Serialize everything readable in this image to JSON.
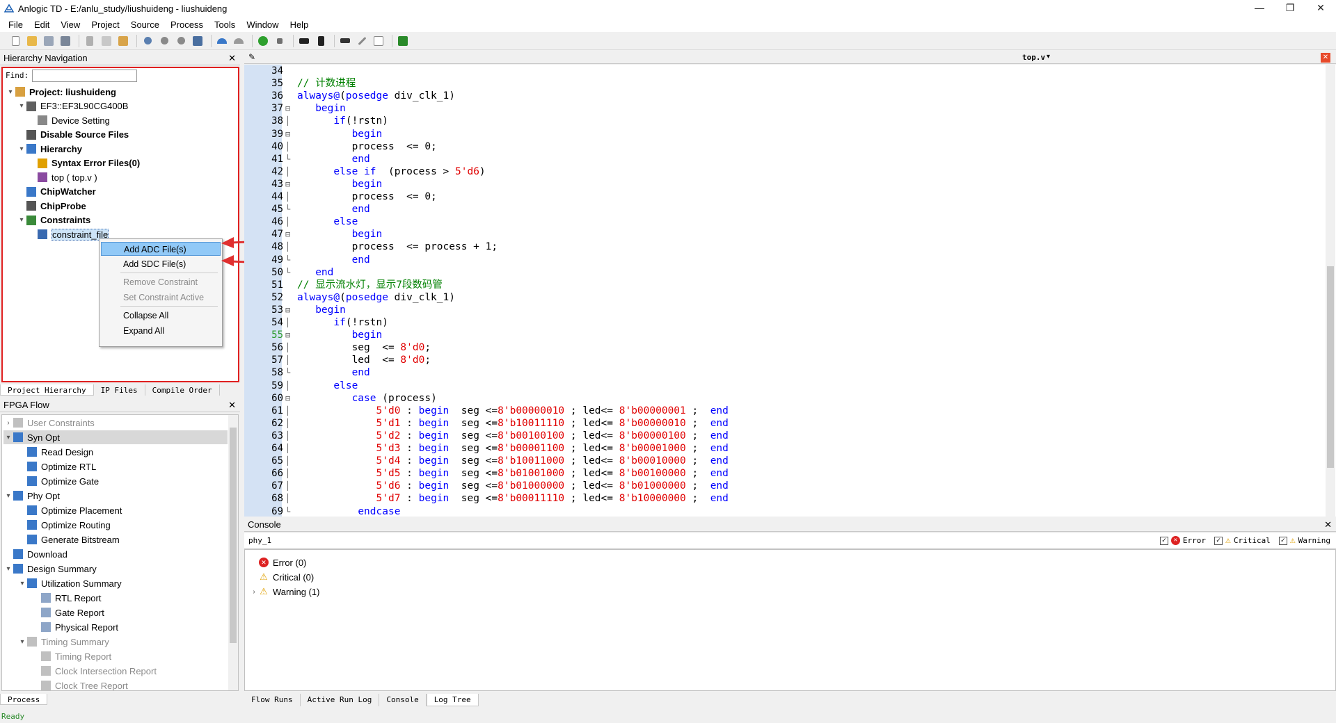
{
  "window": {
    "title": "Anlogic TD - E:/anlu_study/liushuideng - liushuideng",
    "minimize": "—",
    "restore": "❐",
    "close": "✕"
  },
  "menu": [
    "File",
    "Edit",
    "View",
    "Project",
    "Source",
    "Process",
    "Tools",
    "Window",
    "Help"
  ],
  "hierarchy": {
    "title": "Hierarchy Navigation",
    "find_label": "Find:",
    "find_value": "",
    "nodes": [
      {
        "label": "Project: liushuideng",
        "level": 0,
        "bold": true,
        "expand": "v"
      },
      {
        "label": "EF3::EF3L90CG400B",
        "level": 1,
        "bold": false,
        "expand": "v"
      },
      {
        "label": "Device Setting",
        "level": 2,
        "bold": false,
        "expand": ""
      },
      {
        "label": "Disable Source Files",
        "level": 1,
        "bold": true,
        "expand": ""
      },
      {
        "label": "Hierarchy",
        "level": 1,
        "bold": true,
        "expand": "v"
      },
      {
        "label": "Syntax Error Files(0)",
        "level": 2,
        "bold": true,
        "expand": ""
      },
      {
        "label": "top ( top.v )",
        "level": 2,
        "bold": false,
        "expand": ""
      },
      {
        "label": "ChipWatcher",
        "level": 1,
        "bold": true,
        "expand": ""
      },
      {
        "label": "ChipProbe",
        "level": 1,
        "bold": true,
        "expand": ""
      },
      {
        "label": "Constraints",
        "level": 1,
        "bold": true,
        "expand": "v"
      },
      {
        "label": "constraint_file",
        "level": 2,
        "bold": false,
        "expand": ""
      }
    ],
    "tabs": [
      "Project Hierarchy",
      "IP Files",
      "Compile Order"
    ]
  },
  "context_menu": {
    "items": [
      {
        "label": "Add ADC File(s)",
        "enabled": true,
        "highlight": true
      },
      {
        "label": "Add SDC File(s)",
        "enabled": true,
        "highlight": false
      },
      {
        "label": "Remove Constraint",
        "enabled": false,
        "highlight": false
      },
      {
        "label": "Set Constraint Active",
        "enabled": false,
        "highlight": false
      },
      {
        "label": "Collapse All",
        "enabled": true,
        "highlight": false
      },
      {
        "label": "Expand All",
        "enabled": true,
        "highlight": false
      }
    ]
  },
  "flow": {
    "title": "FPGA Flow",
    "nodes": [
      {
        "label": "User Constraints",
        "level": 0,
        "gray": true,
        "expand": ">"
      },
      {
        "label": "Syn Opt",
        "level": 0,
        "gray": false,
        "expand": "v",
        "selected": true
      },
      {
        "label": "Read Design",
        "level": 1,
        "gray": false,
        "expand": ""
      },
      {
        "label": "Optimize RTL",
        "level": 1,
        "gray": false,
        "expand": ""
      },
      {
        "label": "Optimize Gate",
        "level": 1,
        "gray": false,
        "expand": ""
      },
      {
        "label": "Phy Opt",
        "level": 0,
        "gray": false,
        "expand": "v"
      },
      {
        "label": "Optimize Placement",
        "level": 1,
        "gray": false,
        "expand": ""
      },
      {
        "label": "Optimize Routing",
        "level": 1,
        "gray": false,
        "expand": ""
      },
      {
        "label": "Generate Bitstream",
        "level": 1,
        "gray": false,
        "expand": ""
      },
      {
        "label": "Download",
        "level": 0,
        "gray": false,
        "expand": ""
      },
      {
        "label": "Design Summary",
        "level": 0,
        "gray": false,
        "expand": "v"
      },
      {
        "label": "Utilization Summary",
        "level": 1,
        "gray": false,
        "expand": "v"
      },
      {
        "label": "RTL Report",
        "level": 2,
        "gray": false,
        "expand": ""
      },
      {
        "label": "Gate Report",
        "level": 2,
        "gray": false,
        "expand": ""
      },
      {
        "label": "Physical Report",
        "level": 2,
        "gray": false,
        "expand": ""
      },
      {
        "label": "Timing Summary",
        "level": 1,
        "gray": true,
        "expand": "v"
      },
      {
        "label": "Timing Report",
        "level": 2,
        "gray": true,
        "expand": ""
      },
      {
        "label": "Clock Intersection Report",
        "level": 2,
        "gray": true,
        "expand": ""
      },
      {
        "label": "Clock Tree Report",
        "level": 2,
        "gray": true,
        "expand": ""
      }
    ],
    "tab": "Process"
  },
  "editor": {
    "tab_title": "top.v",
    "lines": [
      {
        "n": "34",
        "f": "",
        "t": [
          [
            "",
            ""
          ]
        ]
      },
      {
        "n": "35",
        "f": "",
        "t": [
          [
            "cm",
            "// 计数进程"
          ]
        ]
      },
      {
        "n": "36",
        "f": "",
        "t": [
          [
            "kw",
            "always@"
          ],
          [
            "",
            "("
          ],
          [
            "kw",
            "posedge"
          ],
          [
            "",
            " div_clk_1)"
          ]
        ]
      },
      {
        "n": "37",
        "f": "⊟",
        "t": [
          [
            "",
            "   "
          ],
          [
            "kw",
            "begin"
          ]
        ]
      },
      {
        "n": "38",
        "f": "│",
        "t": [
          [
            "",
            "      "
          ],
          [
            "kw",
            "if"
          ],
          [
            "",
            "(!rstn)"
          ]
        ]
      },
      {
        "n": "39",
        "f": "⊟",
        "t": [
          [
            "",
            "         "
          ],
          [
            "kw",
            "begin"
          ]
        ]
      },
      {
        "n": "40",
        "f": "│",
        "t": [
          [
            "",
            "         process  <= 0;"
          ]
        ]
      },
      {
        "n": "41",
        "f": "└",
        "t": [
          [
            "",
            "         "
          ],
          [
            "kw",
            "end"
          ]
        ]
      },
      {
        "n": "42",
        "f": "│",
        "t": [
          [
            "",
            "      "
          ],
          [
            "kw",
            "else if"
          ],
          [
            "",
            "  (process > "
          ],
          [
            "num",
            "5'd6"
          ],
          [
            "",
            ")"
          ]
        ]
      },
      {
        "n": "43",
        "f": "⊟",
        "t": [
          [
            "",
            "         "
          ],
          [
            "kw",
            "begin"
          ]
        ]
      },
      {
        "n": "44",
        "f": "│",
        "t": [
          [
            "",
            "         process  <= 0;"
          ]
        ]
      },
      {
        "n": "45",
        "f": "└",
        "t": [
          [
            "",
            "         "
          ],
          [
            "kw",
            "end"
          ]
        ]
      },
      {
        "n": "46",
        "f": "│",
        "t": [
          [
            "",
            "      "
          ],
          [
            "kw",
            "else"
          ]
        ]
      },
      {
        "n": "47",
        "f": "⊟",
        "t": [
          [
            "",
            "         "
          ],
          [
            "kw",
            "begin"
          ]
        ]
      },
      {
        "n": "48",
        "f": "│",
        "t": [
          [
            "",
            "         process  <= process + 1;"
          ]
        ]
      },
      {
        "n": "49",
        "f": "└",
        "t": [
          [
            "",
            "         "
          ],
          [
            "kw",
            "end"
          ]
        ]
      },
      {
        "n": "50",
        "f": "└",
        "t": [
          [
            "",
            "   "
          ],
          [
            "kw",
            "end"
          ]
        ]
      },
      {
        "n": "51",
        "f": "",
        "t": [
          [
            "cm",
            "// 显示流水灯，显示7段数码管"
          ]
        ]
      },
      {
        "n": "52",
        "f": "",
        "t": [
          [
            "kw",
            "always@"
          ],
          [
            "",
            "("
          ],
          [
            "kw",
            "posedge"
          ],
          [
            "",
            " div_clk_1)"
          ]
        ]
      },
      {
        "n": "53",
        "f": "⊟",
        "t": [
          [
            "",
            "   "
          ],
          [
            "kw",
            "begin"
          ]
        ]
      },
      {
        "n": "54",
        "f": "│",
        "t": [
          [
            "",
            "      "
          ],
          [
            "kw",
            "if"
          ],
          [
            "",
            "(!rstn)"
          ]
        ]
      },
      {
        "n": "55",
        "f": "⊟",
        "t": [
          [
            "",
            "         "
          ],
          [
            "kw",
            "begin"
          ]
        ]
      },
      {
        "n": "56",
        "f": "│",
        "t": [
          [
            "",
            "         seg  <= "
          ],
          [
            "num",
            "8'd0"
          ],
          [
            "",
            ";"
          ]
        ]
      },
      {
        "n": "57",
        "f": "│",
        "t": [
          [
            "",
            "         led  <= "
          ],
          [
            "num",
            "8'd0"
          ],
          [
            "",
            ";"
          ]
        ]
      },
      {
        "n": "58",
        "f": "└",
        "t": [
          [
            "",
            "         "
          ],
          [
            "kw",
            "end"
          ]
        ]
      },
      {
        "n": "59",
        "f": "│",
        "t": [
          [
            "",
            "      "
          ],
          [
            "kw",
            "else"
          ]
        ]
      },
      {
        "n": "60",
        "f": "⊟",
        "t": [
          [
            "",
            "         "
          ],
          [
            "kw",
            "case"
          ],
          [
            "",
            " (process)"
          ]
        ]
      },
      {
        "n": "61",
        "f": "│",
        "t": [
          [
            "",
            "             "
          ],
          [
            "num",
            "5'd0"
          ],
          [
            "",
            " : "
          ],
          [
            "kw",
            "begin"
          ],
          [
            "",
            "  seg <="
          ],
          [
            "num",
            "8'b00000010"
          ],
          [
            "",
            " ; led<= "
          ],
          [
            "num",
            "8'b00000001"
          ],
          [
            "",
            " ;  "
          ],
          [
            "kw",
            "end"
          ]
        ]
      },
      {
        "n": "62",
        "f": "│",
        "t": [
          [
            "",
            "             "
          ],
          [
            "num",
            "5'd1"
          ],
          [
            "",
            " : "
          ],
          [
            "kw",
            "begin"
          ],
          [
            "",
            "  seg <="
          ],
          [
            "num",
            "8'b10011110"
          ],
          [
            "",
            " ; led<= "
          ],
          [
            "num",
            "8'b00000010"
          ],
          [
            "",
            " ;  "
          ],
          [
            "kw",
            "end"
          ]
        ]
      },
      {
        "n": "63",
        "f": "│",
        "t": [
          [
            "",
            "             "
          ],
          [
            "num",
            "5'd2"
          ],
          [
            "",
            " : "
          ],
          [
            "kw",
            "begin"
          ],
          [
            "",
            "  seg <="
          ],
          [
            "num",
            "8'b00100100"
          ],
          [
            "",
            " ; led<= "
          ],
          [
            "num",
            "8'b00000100"
          ],
          [
            "",
            " ;  "
          ],
          [
            "kw",
            "end"
          ]
        ]
      },
      {
        "n": "64",
        "f": "│",
        "t": [
          [
            "",
            "             "
          ],
          [
            "num",
            "5'd3"
          ],
          [
            "",
            " : "
          ],
          [
            "kw",
            "begin"
          ],
          [
            "",
            "  seg <="
          ],
          [
            "num",
            "8'b00001100"
          ],
          [
            "",
            " ; led<= "
          ],
          [
            "num",
            "8'b00001000"
          ],
          [
            "",
            " ;  "
          ],
          [
            "kw",
            "end"
          ]
        ]
      },
      {
        "n": "65",
        "f": "│",
        "t": [
          [
            "",
            "             "
          ],
          [
            "num",
            "5'd4"
          ],
          [
            "",
            " : "
          ],
          [
            "kw",
            "begin"
          ],
          [
            "",
            "  seg <="
          ],
          [
            "num",
            "8'b10011000"
          ],
          [
            "",
            " ; led<= "
          ],
          [
            "num",
            "8'b00010000"
          ],
          [
            "",
            " ;  "
          ],
          [
            "kw",
            "end"
          ]
        ]
      },
      {
        "n": "66",
        "f": "│",
        "t": [
          [
            "",
            "             "
          ],
          [
            "num",
            "5'd5"
          ],
          [
            "",
            " : "
          ],
          [
            "kw",
            "begin"
          ],
          [
            "",
            "  seg <="
          ],
          [
            "num",
            "8'b01001000"
          ],
          [
            "",
            " ; led<= "
          ],
          [
            "num",
            "8'b00100000"
          ],
          [
            "",
            " ;  "
          ],
          [
            "kw",
            "end"
          ]
        ]
      },
      {
        "n": "67",
        "f": "│",
        "t": [
          [
            "",
            "             "
          ],
          [
            "num",
            "5'd6"
          ],
          [
            "",
            " : "
          ],
          [
            "kw",
            "begin"
          ],
          [
            "",
            "  seg <="
          ],
          [
            "num",
            "8'b01000000"
          ],
          [
            "",
            " ; led<= "
          ],
          [
            "num",
            "8'b01000000"
          ],
          [
            "",
            " ;  "
          ],
          [
            "kw",
            "end"
          ]
        ]
      },
      {
        "n": "68",
        "f": "│",
        "t": [
          [
            "",
            "             "
          ],
          [
            "num",
            "5'd7"
          ],
          [
            "",
            " : "
          ],
          [
            "kw",
            "begin"
          ],
          [
            "",
            "  seg <="
          ],
          [
            "num",
            "8'b00011110"
          ],
          [
            "",
            " ; led<= "
          ],
          [
            "num",
            "8'b10000000"
          ],
          [
            "",
            " ;  "
          ],
          [
            "kw",
            "end"
          ]
        ]
      },
      {
        "n": "69",
        "f": "└",
        "t": [
          [
            "",
            "          "
          ],
          [
            "kw",
            "endcase"
          ]
        ]
      }
    ]
  },
  "console": {
    "title": "Console",
    "run": "phy_1",
    "filters": [
      "Error",
      "Critical",
      "Warning"
    ],
    "items": [
      {
        "label": "Error (0)",
        "kind": "error",
        "expand": ""
      },
      {
        "label": "Critical (0)",
        "kind": "warn",
        "expand": ""
      },
      {
        "label": "Warning (1)",
        "kind": "warn",
        "expand": ">"
      }
    ],
    "tabs": [
      "Flow Runs",
      "Active Run Log",
      "Console",
      "Log Tree"
    ]
  },
  "status": "Ready",
  "colors": {
    "accent": "#1a5fb4",
    "highlight_frame": "#e02020",
    "menu_highlight": "#91c9f7"
  }
}
